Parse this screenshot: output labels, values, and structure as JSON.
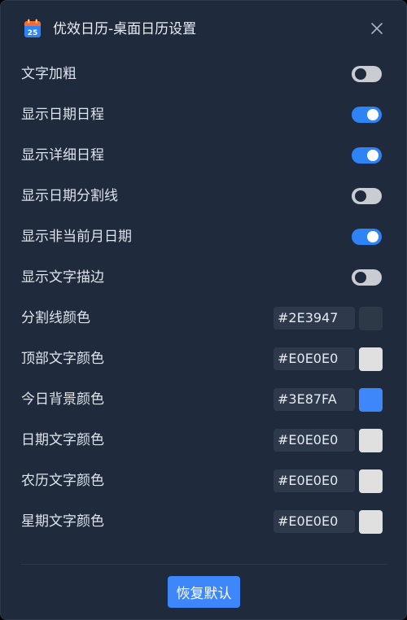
{
  "window": {
    "title": "优效日历-桌面日历设置",
    "app_icon": "calendar-icon",
    "app_icon_day": "25",
    "close_icon": "close-icon"
  },
  "toggles": [
    {
      "label": "文字加粗",
      "on": false
    },
    {
      "label": "显示日期日程",
      "on": true
    },
    {
      "label": "显示详细日程",
      "on": true
    },
    {
      "label": "显示日期分割线",
      "on": false
    },
    {
      "label": "显示非当前月日期",
      "on": true
    },
    {
      "label": "显示文字描边",
      "on": false
    }
  ],
  "colors": [
    {
      "label": "分割线颜色",
      "value": "#2E3947",
      "swatch": "#2E3947"
    },
    {
      "label": "顶部文字颜色",
      "value": "#E0E0E0",
      "swatch": "#E0E0E0"
    },
    {
      "label": "今日背景颜色",
      "value": "#3E87FA",
      "swatch": "#3E87FA"
    },
    {
      "label": "日期文字颜色",
      "value": "#E0E0E0",
      "swatch": "#E0E0E0"
    },
    {
      "label": "农历文字颜色",
      "value": "#E0E0E0",
      "swatch": "#E0E0E0"
    },
    {
      "label": "星期文字颜色",
      "value": "#E0E0E0",
      "swatch": "#E0E0E0"
    }
  ],
  "footer": {
    "reset_label": "恢复默认"
  },
  "theme": {
    "background": "#1f2a3c",
    "accent": "#2f84f5",
    "toggle_off": "#c9ccd1",
    "input_bg": "#2e3a4c"
  }
}
